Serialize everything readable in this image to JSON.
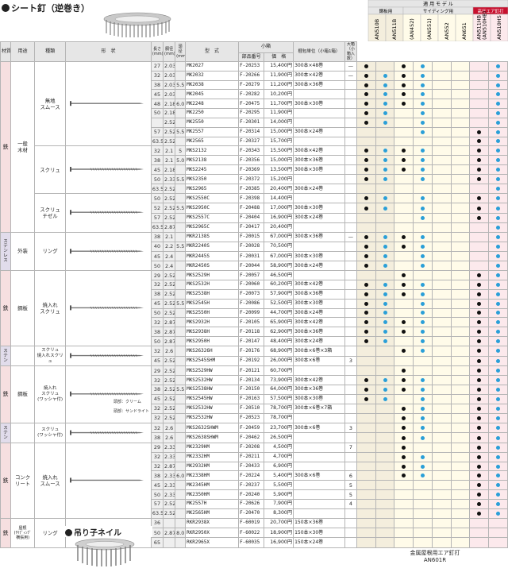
{
  "title": "シート釘（逆巻き）",
  "models_header": {
    "group": "適 用 モ デ ル",
    "roof": "鋼板用",
    "siding": "サイディング用",
    "high": "高圧エア釘打",
    "models": [
      "AN510B",
      "AN511B",
      "(AN452)",
      "(AN551)",
      "AN552",
      "AN651",
      "AN511HB\n(AN510HB)",
      "AN510HS"
    ]
  },
  "cols": {
    "cat": "材質",
    "use": "用途",
    "kind": "種類",
    "shape": "形　状",
    "len": "長さ(mm)",
    "shank": "胴径(mm)",
    "head": "頭径(mm)",
    "type": "型　式",
    "small": "小箱",
    "part": "部品番号",
    "price": "価　格",
    "pack": "梱包単位（小箱1箱）",
    "big": "大箱（小箱入数）"
  },
  "rows": [
    [
      "27",
      "2.03",
      "",
      "MK2027",
      "F-20253",
      "15,400円",
      "300本×48巻",
      "—",
      "1011-0001"
    ],
    [
      "32",
      "2.03",
      "",
      "MK2032",
      "F-20266",
      "11,900円",
      "300本×42巻",
      "—",
      "1111-0001"
    ],
    [
      "38",
      "2.03",
      "5.5",
      "MK2038",
      "F-20279",
      "11,200円",
      "300本×36巻",
      "",
      "1111-0001"
    ],
    [
      "45",
      "2.03",
      "",
      "MK2045",
      "F-20282",
      "10,200円",
      "",
      "",
      "1111-0001"
    ],
    [
      "48",
      "2.18",
      "6.0",
      "MK2248",
      "F-20475",
      "11,700円",
      "300本×30巻",
      "",
      "1111-0001"
    ],
    [
      "50",
      "2.18",
      "",
      "MK2250",
      "F-20295",
      "11,900円",
      "",
      "",
      "1101-0001"
    ],
    [
      "",
      "2.52",
      "",
      "MK2550",
      "F-20301",
      "14,000円",
      "",
      "",
      "1101-0001"
    ],
    [
      "57",
      "2.52",
      "5.5",
      "MK2557",
      "F-20314",
      "15,000円",
      "300本×24巻",
      "",
      "0001-0011"
    ],
    [
      "63.5",
      "2.52",
      "",
      "MK2565",
      "F-20327",
      "15,700円",
      "",
      "",
      "0000-0011"
    ],
    [
      "32",
      "2.1",
      "5",
      "MKS2132",
      "F-20343",
      "15,500円",
      "300本×42巻",
      "",
      "1111-0011"
    ],
    [
      "38",
      "2.1",
      "5.0",
      "MKS2138",
      "F-20356",
      "15,000円",
      "300本×36巻",
      "",
      "1111-0011"
    ],
    [
      "45",
      "2.18",
      "",
      "MKS2245",
      "F-20369",
      "13,500円",
      "300本×30巻",
      "",
      "1111-0011"
    ],
    [
      "50",
      "2.33",
      "5.5",
      "MKS2350",
      "F-20372",
      "15,200円",
      "",
      "",
      "1101-0011"
    ],
    [
      "63.5",
      "2.52",
      "",
      "MKS2965",
      "F-20385",
      "20,400円",
      "300本×24巻",
      "",
      "0000-0001"
    ],
    [
      "50",
      "2.52",
      "",
      "MKS2550C",
      "F-20398",
      "14,400円",
      "",
      "",
      "1101-0011"
    ],
    [
      "52",
      "2.52",
      "5.5",
      "MKS2950C",
      "F-20488",
      "17,000円",
      "300本×30巻",
      "",
      "1101-0011"
    ],
    [
      "57",
      "2.52",
      "",
      "MKS2557C",
      "F-20404",
      "16,900円",
      "300本×24巻",
      "",
      "0001-0011"
    ],
    [
      "63.5",
      "2.87",
      "",
      "MKS2965C",
      "F-20417",
      "20,400円",
      "",
      "",
      "0000-0001"
    ],
    [
      "38",
      "2.1",
      "",
      "MKR2138S",
      "F-20015",
      "67,000円",
      "300本×36巻",
      "—",
      "1111-0001"
    ],
    [
      "40",
      "2.2",
      "5.5",
      "MKR2240S",
      "F-20028",
      "70,500円",
      "",
      "",
      "1111-0001"
    ],
    [
      "45",
      "2.4",
      "",
      "MKR2445S",
      "F-20031",
      "67,000円",
      "300本×30巻",
      "",
      "1101-0001"
    ],
    [
      "50",
      "2.4",
      "",
      "MKR2450S",
      "F-20044",
      "58,900円",
      "300本×24巻",
      "",
      "1101-0001"
    ],
    [
      "29",
      "2.52",
      "",
      "MKS2529H",
      "F-20057",
      "46,500円",
      "",
      "",
      "0010-0011"
    ],
    [
      "32",
      "2.52",
      "",
      "MKS2532H",
      "F-20060",
      "60,200円",
      "300本×42巻",
      "",
      "1111-0011"
    ],
    [
      "38",
      "2.52",
      "",
      "MKS2538H",
      "F-20073",
      "57,900円",
      "300本×36巻",
      "",
      "1111-0011"
    ],
    [
      "45",
      "2.52",
      "5.5",
      "MKS2545H",
      "F-20086",
      "52,500円",
      "300本×30巻",
      "",
      "1101-0011"
    ],
    [
      "50",
      "2.52",
      "",
      "MKS2550H",
      "F-20099",
      "44,700円",
      "300本×24巻",
      "",
      "1101-0011"
    ],
    [
      "32",
      "2.87",
      "",
      "MKS2932H",
      "F-20105",
      "65,900円",
      "300本×42巻",
      "",
      "1111-0011"
    ],
    [
      "38",
      "2.87",
      "",
      "MKS2938H",
      "F-20118",
      "62,900円",
      "300本×36巻",
      "",
      "1111-0011"
    ],
    [
      "50",
      "2.87",
      "",
      "MKS2950H",
      "F-20147",
      "48,400円",
      "300本×24巻",
      "",
      "1101-0011"
    ],
    [
      "32",
      "2.6",
      "",
      "MKS26326H",
      "F-20176",
      "68,900円",
      "300本×6巻×3箱",
      "",
      "0011-0011"
    ],
    [
      "45",
      "2.52",
      "",
      "MKS2545SHM",
      "F-20192",
      "26,000円",
      "300本×6巻",
      "3",
      "0000-0011"
    ],
    [
      "29",
      "2.52",
      "",
      "MKS2529HW",
      "F-20121",
      "60,700円",
      "",
      "",
      "0010-0011"
    ],
    [
      "32",
      "2.52",
      "",
      "MKS2532HW",
      "F-20134",
      "73,900円",
      "300本×42巻",
      "",
      "1111-0011"
    ],
    [
      "38",
      "2.52",
      "5.5",
      "MKS2538HW",
      "F-20150",
      "64,000円",
      "300本×36巻",
      "",
      "1111-0011"
    ],
    [
      "45",
      "2.52",
      "",
      "MKS2545HW",
      "F-20163",
      "57,500円",
      "300本×30巻",
      "",
      "1101-0011"
    ],
    [
      "32",
      "2.52",
      "",
      "MKS2532HW",
      "F-20510",
      "78,700円",
      "300本×6巻×7箱",
      "",
      "0011-0011"
    ],
    [
      "32",
      "2.52",
      "",
      "MKS2532HW",
      "F-20523",
      "78,700円",
      "",
      "",
      "0011-0011"
    ],
    [
      "32",
      "2.6",
      "",
      "MKS2632SHWM",
      "F-20459",
      "23,700円",
      "300本×6巻",
      "3",
      "0011-0011"
    ],
    [
      "38",
      "2.6",
      "",
      "MKS2638SHWM",
      "F-20462",
      "26,500円",
      "",
      "",
      "0011-0011"
    ],
    [
      "29",
      "2.33",
      "",
      "MK2329HM",
      "F-20208",
      "4,500円",
      "",
      "7",
      "0010-0011"
    ],
    [
      "32",
      "2.33",
      "",
      "MK2332HM",
      "F-20211",
      "4,700円",
      "",
      "",
      "0011-0011"
    ],
    [
      "32",
      "2.87",
      "",
      "MK2932HM",
      "F-20433",
      "6,900円",
      "",
      "",
      "0011-0011"
    ],
    [
      "38",
      "2.33",
      "6.0",
      "MK2338HM",
      "F-20224",
      "5,400円",
      "300本×6巻",
      "6",
      "0011-0011"
    ],
    [
      "45",
      "2.33",
      "",
      "MK2345HM",
      "F-20237",
      "5,500円",
      "",
      "5",
      "0000-0011"
    ],
    [
      "50",
      "2.33",
      "",
      "MK2350HM",
      "F-20240",
      "5,900円",
      "",
      "5",
      "0000-0011"
    ],
    [
      "57",
      "2.52",
      "",
      "MK2557H",
      "F-20626",
      "7,900円",
      "",
      "4",
      "0000-0011"
    ],
    [
      "63.5",
      "2.52",
      "",
      "MK2565HM",
      "F-20470",
      "8,300円",
      "",
      "",
      "0000-0011"
    ],
    [
      "36",
      "",
      "",
      "RKR2938X",
      "F-60019",
      "20,700円",
      "150本×36巻",
      "",
      "0000-0000"
    ],
    [
      "50",
      "2.87",
      "8.0",
      "RKR2950X",
      "F-60022",
      "18,900円",
      "150本×30巻",
      "",
      "0000-0000"
    ],
    [
      "65",
      "",
      "",
      "RKR2965X",
      "F-60035",
      "16,900円",
      "150本×24巻",
      "",
      "0000-0000"
    ]
  ],
  "groups": [
    {
      "cat": "鉄",
      "ss": false,
      "rows": [
        0,
        17
      ],
      "use": "一般\n木材"
    },
    {
      "cat": "ステンレス",
      "ss": true,
      "rows": [
        18,
        21
      ],
      "use": "外装"
    },
    {
      "cat": "鉄",
      "ss": false,
      "rows": [
        22,
        29
      ],
      "use": "鋼板"
    },
    {
      "cat": "ステン",
      "ss": true,
      "rows": [
        30,
        31
      ],
      "use": ""
    },
    {
      "cat": "鉄",
      "ss": false,
      "rows": [
        32,
        37
      ],
      "use": "鋼板"
    },
    {
      "cat": "ステン",
      "ss": true,
      "rows": [
        38,
        39
      ],
      "use": ""
    },
    {
      "cat": "鉄",
      "ss": false,
      "rows": [
        40,
        47
      ],
      "use": "コンク\nリート"
    },
    {
      "cat": "鉄",
      "ss": false,
      "rows": [
        48,
        50
      ],
      "use": "屋根\n(ｻｲﾃﾞｨﾝｸﾞ\n横張用)"
    }
  ],
  "kinds": [
    {
      "rows": [
        0,
        8
      ],
      "label": "無地\nスムース"
    },
    {
      "rows": [
        9,
        13
      ],
      "label": "スクリュ"
    },
    {
      "rows": [
        14,
        17
      ],
      "label": "スクリュ\nチゼル"
    },
    {
      "rows": [
        18,
        21
      ],
      "label": "リング"
    },
    {
      "rows": [
        22,
        29
      ],
      "label": "焼入れ\nスクリュ"
    },
    {
      "rows": [
        30,
        31
      ],
      "label": "スクリュ\n焼入れスクリュ"
    },
    {
      "rows": [
        32,
        37
      ],
      "label": "焼入れ\nスクリュ\n(ワッシャ付)"
    },
    {
      "rows": [
        38,
        39
      ],
      "label": "スクリュ\n(ワッシャ付)"
    },
    {
      "rows": [
        40,
        47
      ],
      "label": "焼入れ\nスムース"
    },
    {
      "rows": [
        48,
        50
      ],
      "label": "リング"
    }
  ],
  "head_notes": {
    "cream": "頭部：クリーム",
    "sand": "頭部：サンドライト"
  },
  "section2_title": "吊り子ネイル",
  "bottom_note": "金属屋根用エア釘打\nAN601R",
  "colors": {
    "dot_black": "#111111",
    "dot_blue": "#2a9fd8",
    "ss_bg": "#e1dceb",
    "fe_bg": "#f6dfe0",
    "header_bg": "#e6e6e6",
    "high": "#c8102e"
  },
  "icons": [
    "coil-nail-image",
    "nail-shape-image"
  ]
}
